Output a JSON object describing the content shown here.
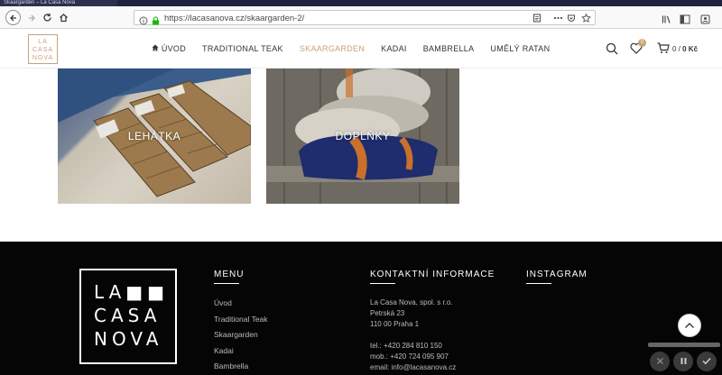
{
  "browser": {
    "tab_title": "Skaargarden – La Casa Nova",
    "url": "https://lacasanova.cz/skaargarden-2/",
    "icons": [
      "back-icon",
      "forward-icon",
      "reload-icon",
      "home-icon",
      "info-icon",
      "lock-icon",
      "reader-icon",
      "more-icon",
      "pocket-icon",
      "bookmark-star-icon",
      "library-icon",
      "sidebar-icon",
      "account-icon"
    ]
  },
  "header": {
    "logo_lines": [
      "LA",
      "CASA",
      "NOVA"
    ],
    "menu": [
      {
        "label": "ÚVOD",
        "icon": "home-icon",
        "active": false
      },
      {
        "label": "TRADITIONAL TEAK",
        "active": false
      },
      {
        "label": "SKAARGARDEN",
        "active": true
      },
      {
        "label": "KADAI",
        "active": false
      },
      {
        "label": "BAMBRELLA",
        "active": false
      },
      {
        "label": "UMĚLÝ RATAN",
        "active": false
      }
    ],
    "wishlist_count": "0",
    "cart_count": "0",
    "cart_total": "0 Kč",
    "accent_color": "#c9a27a"
  },
  "categories": [
    {
      "label": "LEHÁTKA"
    },
    {
      "label": "DOPLŇKY"
    }
  ],
  "footer": {
    "logo_lines": [
      "LA■■",
      "CASA",
      "NOVA"
    ],
    "menu_title": "MENU",
    "menu_items": [
      "Úvod",
      "Traditional Teak",
      "Skaargarden",
      "Kadai",
      "Bambrella"
    ],
    "contact_title": "KONTAKTNÍ INFORMACE",
    "contact": {
      "company": "La Casa Nova, spol. s r.o.",
      "street": "Petrská 23",
      "city": "110 00 Praha 1",
      "phone": "tel.: +420 284 810 150",
      "mobile": "mob.: +420 724 095 907",
      "email": "email: info@lacasanova.cz"
    },
    "instagram_title": "INSTAGRAM"
  }
}
